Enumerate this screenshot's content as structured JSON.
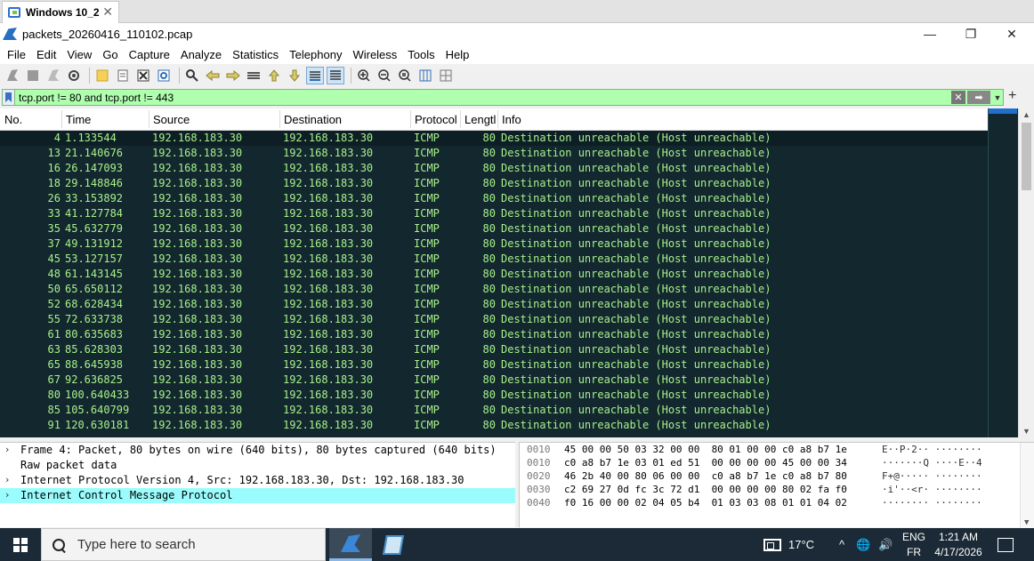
{
  "vm_tab": {
    "label": "Windows 10_2",
    "close": "✕"
  },
  "window": {
    "title": "packets_20260416_110102.pcap",
    "minimize": "—",
    "maximize": "❐",
    "close": "✕"
  },
  "menu": [
    "File",
    "Edit",
    "View",
    "Go",
    "Capture",
    "Analyze",
    "Statistics",
    "Telephony",
    "Wireless",
    "Tools",
    "Help"
  ],
  "filter": {
    "text": "tcp.port != 80 and tcp.port != 443",
    "clear": "✕",
    "apply": "➡",
    "dropdown": "▼",
    "add": "+"
  },
  "packet_list": {
    "headers": {
      "no": "No.",
      "time": "Time",
      "source": "Source",
      "destination": "Destination",
      "protocol": "Protocol",
      "length": "Lengtl",
      "info": "Info"
    },
    "rows": [
      {
        "no": "4",
        "time": "1.133544",
        "src": "192.168.183.30",
        "dst": "192.168.183.30",
        "proto": "ICMP",
        "len": "80",
        "info": "Destination unreachable (Host unreachable)"
      },
      {
        "no": "13",
        "time": "21.140676",
        "src": "192.168.183.30",
        "dst": "192.168.183.30",
        "proto": "ICMP",
        "len": "80",
        "info": "Destination unreachable (Host unreachable)"
      },
      {
        "no": "16",
        "time": "26.147093",
        "src": "192.168.183.30",
        "dst": "192.168.183.30",
        "proto": "ICMP",
        "len": "80",
        "info": "Destination unreachable (Host unreachable)"
      },
      {
        "no": "18",
        "time": "29.148846",
        "src": "192.168.183.30",
        "dst": "192.168.183.30",
        "proto": "ICMP",
        "len": "80",
        "info": "Destination unreachable (Host unreachable)"
      },
      {
        "no": "26",
        "time": "33.153892",
        "src": "192.168.183.30",
        "dst": "192.168.183.30",
        "proto": "ICMP",
        "len": "80",
        "info": "Destination unreachable (Host unreachable)"
      },
      {
        "no": "33",
        "time": "41.127784",
        "src": "192.168.183.30",
        "dst": "192.168.183.30",
        "proto": "ICMP",
        "len": "80",
        "info": "Destination unreachable (Host unreachable)"
      },
      {
        "no": "35",
        "time": "45.632779",
        "src": "192.168.183.30",
        "dst": "192.168.183.30",
        "proto": "ICMP",
        "len": "80",
        "info": "Destination unreachable (Host unreachable)"
      },
      {
        "no": "37",
        "time": "49.131912",
        "src": "192.168.183.30",
        "dst": "192.168.183.30",
        "proto": "ICMP",
        "len": "80",
        "info": "Destination unreachable (Host unreachable)"
      },
      {
        "no": "45",
        "time": "53.127157",
        "src": "192.168.183.30",
        "dst": "192.168.183.30",
        "proto": "ICMP",
        "len": "80",
        "info": "Destination unreachable (Host unreachable)"
      },
      {
        "no": "48",
        "time": "61.143145",
        "src": "192.168.183.30",
        "dst": "192.168.183.30",
        "proto": "ICMP",
        "len": "80",
        "info": "Destination unreachable (Host unreachable)"
      },
      {
        "no": "50",
        "time": "65.650112",
        "src": "192.168.183.30",
        "dst": "192.168.183.30",
        "proto": "ICMP",
        "len": "80",
        "info": "Destination unreachable (Host unreachable)"
      },
      {
        "no": "52",
        "time": "68.628434",
        "src": "192.168.183.30",
        "dst": "192.168.183.30",
        "proto": "ICMP",
        "len": "80",
        "info": "Destination unreachable (Host unreachable)"
      },
      {
        "no": "55",
        "time": "72.633738",
        "src": "192.168.183.30",
        "dst": "192.168.183.30",
        "proto": "ICMP",
        "len": "80",
        "info": "Destination unreachable (Host unreachable)"
      },
      {
        "no": "61",
        "time": "80.635683",
        "src": "192.168.183.30",
        "dst": "192.168.183.30",
        "proto": "ICMP",
        "len": "80",
        "info": "Destination unreachable (Host unreachable)"
      },
      {
        "no": "63",
        "time": "85.628303",
        "src": "192.168.183.30",
        "dst": "192.168.183.30",
        "proto": "ICMP",
        "len": "80",
        "info": "Destination unreachable (Host unreachable)"
      },
      {
        "no": "65",
        "time": "88.645938",
        "src": "192.168.183.30",
        "dst": "192.168.183.30",
        "proto": "ICMP",
        "len": "80",
        "info": "Destination unreachable (Host unreachable)"
      },
      {
        "no": "67",
        "time": "92.636825",
        "src": "192.168.183.30",
        "dst": "192.168.183.30",
        "proto": "ICMP",
        "len": "80",
        "info": "Destination unreachable (Host unreachable)"
      },
      {
        "no": "80",
        "time": "100.640433",
        "src": "192.168.183.30",
        "dst": "192.168.183.30",
        "proto": "ICMP",
        "len": "80",
        "info": "Destination unreachable (Host unreachable)"
      },
      {
        "no": "85",
        "time": "105.640799",
        "src": "192.168.183.30",
        "dst": "192.168.183.30",
        "proto": "ICMP",
        "len": "80",
        "info": "Destination unreachable (Host unreachable)"
      },
      {
        "no": "91",
        "time": "120.630181",
        "src": "192.168.183.30",
        "dst": "192.168.183.30",
        "proto": "ICMP",
        "len": "80",
        "info": "Destination unreachable (Host unreachable)"
      }
    ]
  },
  "details": [
    {
      "chevron": "›",
      "text": "Frame 4: Packet, 80 bytes on wire (640 bits), 80 bytes captured (640 bits)",
      "highlighted": false
    },
    {
      "chevron": "",
      "text": "Raw packet data",
      "highlighted": false
    },
    {
      "chevron": "›",
      "text": "Internet Protocol Version 4, Src: 192.168.183.30, Dst: 192.168.183.30",
      "highlighted": false
    },
    {
      "chevron": "›",
      "text": "Internet Control Message Protocol",
      "highlighted": true
    }
  ],
  "bytes": [
    {
      "offset": "0010",
      "hex": "45 00 00 50 03 32 00 00  80 01 00 00 c0 a8 b7 1e",
      "ascii": "E··P·2·· ········"
    },
    {
      "offset": "0010",
      "hex": "c0 a8 b7 1e 03 01 ed 51  00 00 00 00 45 00 00 34",
      "ascii": "·······Q ····E··4"
    },
    {
      "offset": "0020",
      "hex": "46 2b 40 00 80 06 00 00  c0 a8 b7 1e c0 a8 b7 80",
      "ascii": "F+@····· ········"
    },
    {
      "offset": "0030",
      "hex": "c2 69 27 0d fc 3c 72 d1  00 00 00 00 80 02 fa f0",
      "ascii": "·i'··<r· ········"
    },
    {
      "offset": "0040",
      "hex": "f0 16 00 00 02 04 05 b4  01 03 03 08 01 01 04 02",
      "ascii": "········ ········"
    }
  ],
  "taskbar": {
    "search_placeholder": "Type here to search",
    "temperature": "17°C",
    "language_top": "ENG",
    "language_bottom": "FR",
    "time": "1:21 AM",
    "date": "4/17/2026",
    "tray_chevron": "^",
    "globe": "🌐",
    "speaker": "🔊"
  }
}
